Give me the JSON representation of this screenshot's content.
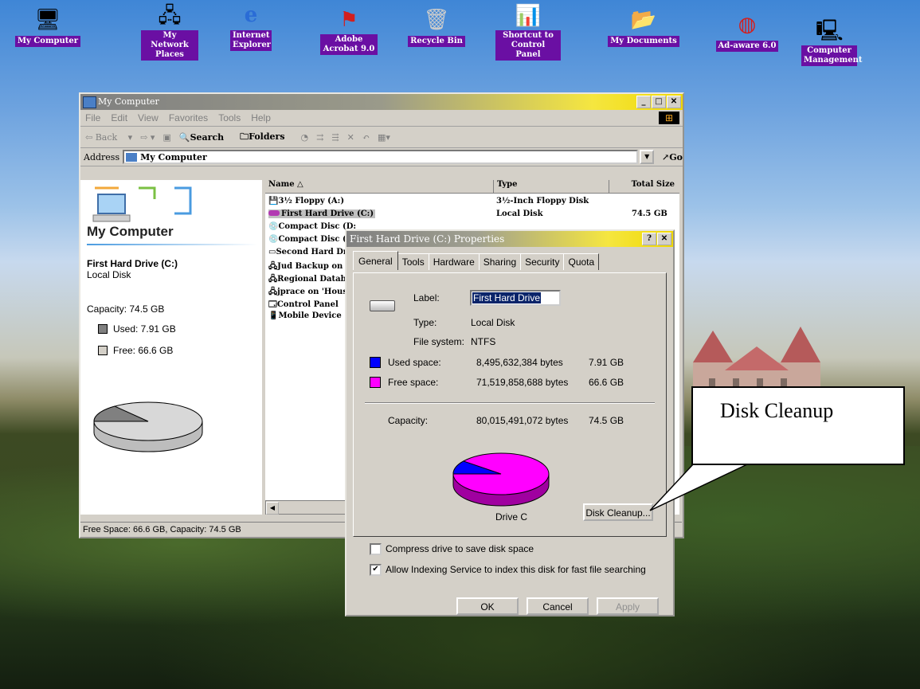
{
  "desktop": {
    "icons": [
      {
        "label": "My Computer",
        "icon": "computer-icon"
      },
      {
        "label": "My Network Places",
        "icon": "network-icon"
      },
      {
        "label": "Internet Explorer",
        "icon": "ie-icon"
      },
      {
        "label": "Adobe Acrobat 9.0",
        "icon": "acrobat-icon"
      },
      {
        "label": "Recycle Bin",
        "icon": "recycle-bin-icon"
      },
      {
        "label": "Shortcut to Control Panel",
        "icon": "control-panel-icon"
      },
      {
        "label": "My Documents",
        "icon": "documents-icon"
      },
      {
        "label": "Ad-aware 6.0",
        "icon": "adaware-icon"
      },
      {
        "label": "Computer Management",
        "icon": "management-icon"
      }
    ]
  },
  "explorer": {
    "title": "My Computer",
    "menu": [
      "File",
      "Edit",
      "View",
      "Favorites",
      "Tools",
      "Help"
    ],
    "toolbar": {
      "back": "Back",
      "search": "Search",
      "folders": "Folders"
    },
    "address_label": "Address",
    "address_value": "My Computer",
    "go": "Go",
    "sidebar": {
      "heading": "My Computer",
      "drive_name": "First Hard Drive (C:)",
      "drive_type": "Local Disk",
      "capacity": "Capacity: 74.5 GB",
      "used": "Used: 7.91 GB",
      "free": "Free: 66.6 GB"
    },
    "columns": [
      "Name",
      "Type",
      "Total Size"
    ],
    "items": [
      {
        "name": "3½ Floppy (A:)",
        "type": "3½-Inch Floppy Disk",
        "size": ""
      },
      {
        "name": "First Hard Drive (C:)",
        "type": "Local Disk",
        "size": "74.5 GB"
      },
      {
        "name": "Compact Disc (D:",
        "type": "",
        "size": ""
      },
      {
        "name": "Compact Disc (E:",
        "type": "",
        "size": ""
      },
      {
        "name": "Second Hard Dri",
        "type": "",
        "size": ""
      },
      {
        "name": "Jud Backup on '",
        "type": "",
        "size": ""
      },
      {
        "name": "Regional Databa",
        "type": "",
        "size": ""
      },
      {
        "name": "jprace on 'Housi",
        "type": "",
        "size": ""
      },
      {
        "name": "Control Panel",
        "type": "",
        "size": ""
      },
      {
        "name": "Mobile Device",
        "type": "",
        "size": ""
      }
    ],
    "status": "Free Space: 66.6 GB, Capacity: 74.5 GB"
  },
  "dialog": {
    "title": "First Hard Drive (C:) Properties",
    "tabs": [
      "General",
      "Tools",
      "Hardware",
      "Sharing",
      "Security",
      "Quota"
    ],
    "label_caption": "Label:",
    "label_value": "First Hard Drive",
    "type_caption": "Type:",
    "type_value": "Local Disk",
    "fs_caption": "File system:",
    "fs_value": "NTFS",
    "used_caption": "Used space:",
    "used_bytes": "8,495,632,384 bytes",
    "used_gb": "7.91 GB",
    "free_caption": "Free space:",
    "free_bytes": "71,519,858,688 bytes",
    "free_gb": "66.6 GB",
    "cap_caption": "Capacity:",
    "cap_bytes": "80,015,491,072 bytes",
    "cap_gb": "74.5 GB",
    "drive_label": "Drive C",
    "cleanup": "Disk Cleanup...",
    "compress": "Compress drive to save disk space",
    "indexing": "Allow Indexing Service to index this disk for fast file searching",
    "ok": "OK",
    "cancel": "Cancel",
    "apply": "Apply",
    "used_fraction": 0.106,
    "colors": {
      "used": "#0000ff",
      "free": "#ff00ff"
    }
  },
  "callout": {
    "text": "Disk Cleanup"
  }
}
